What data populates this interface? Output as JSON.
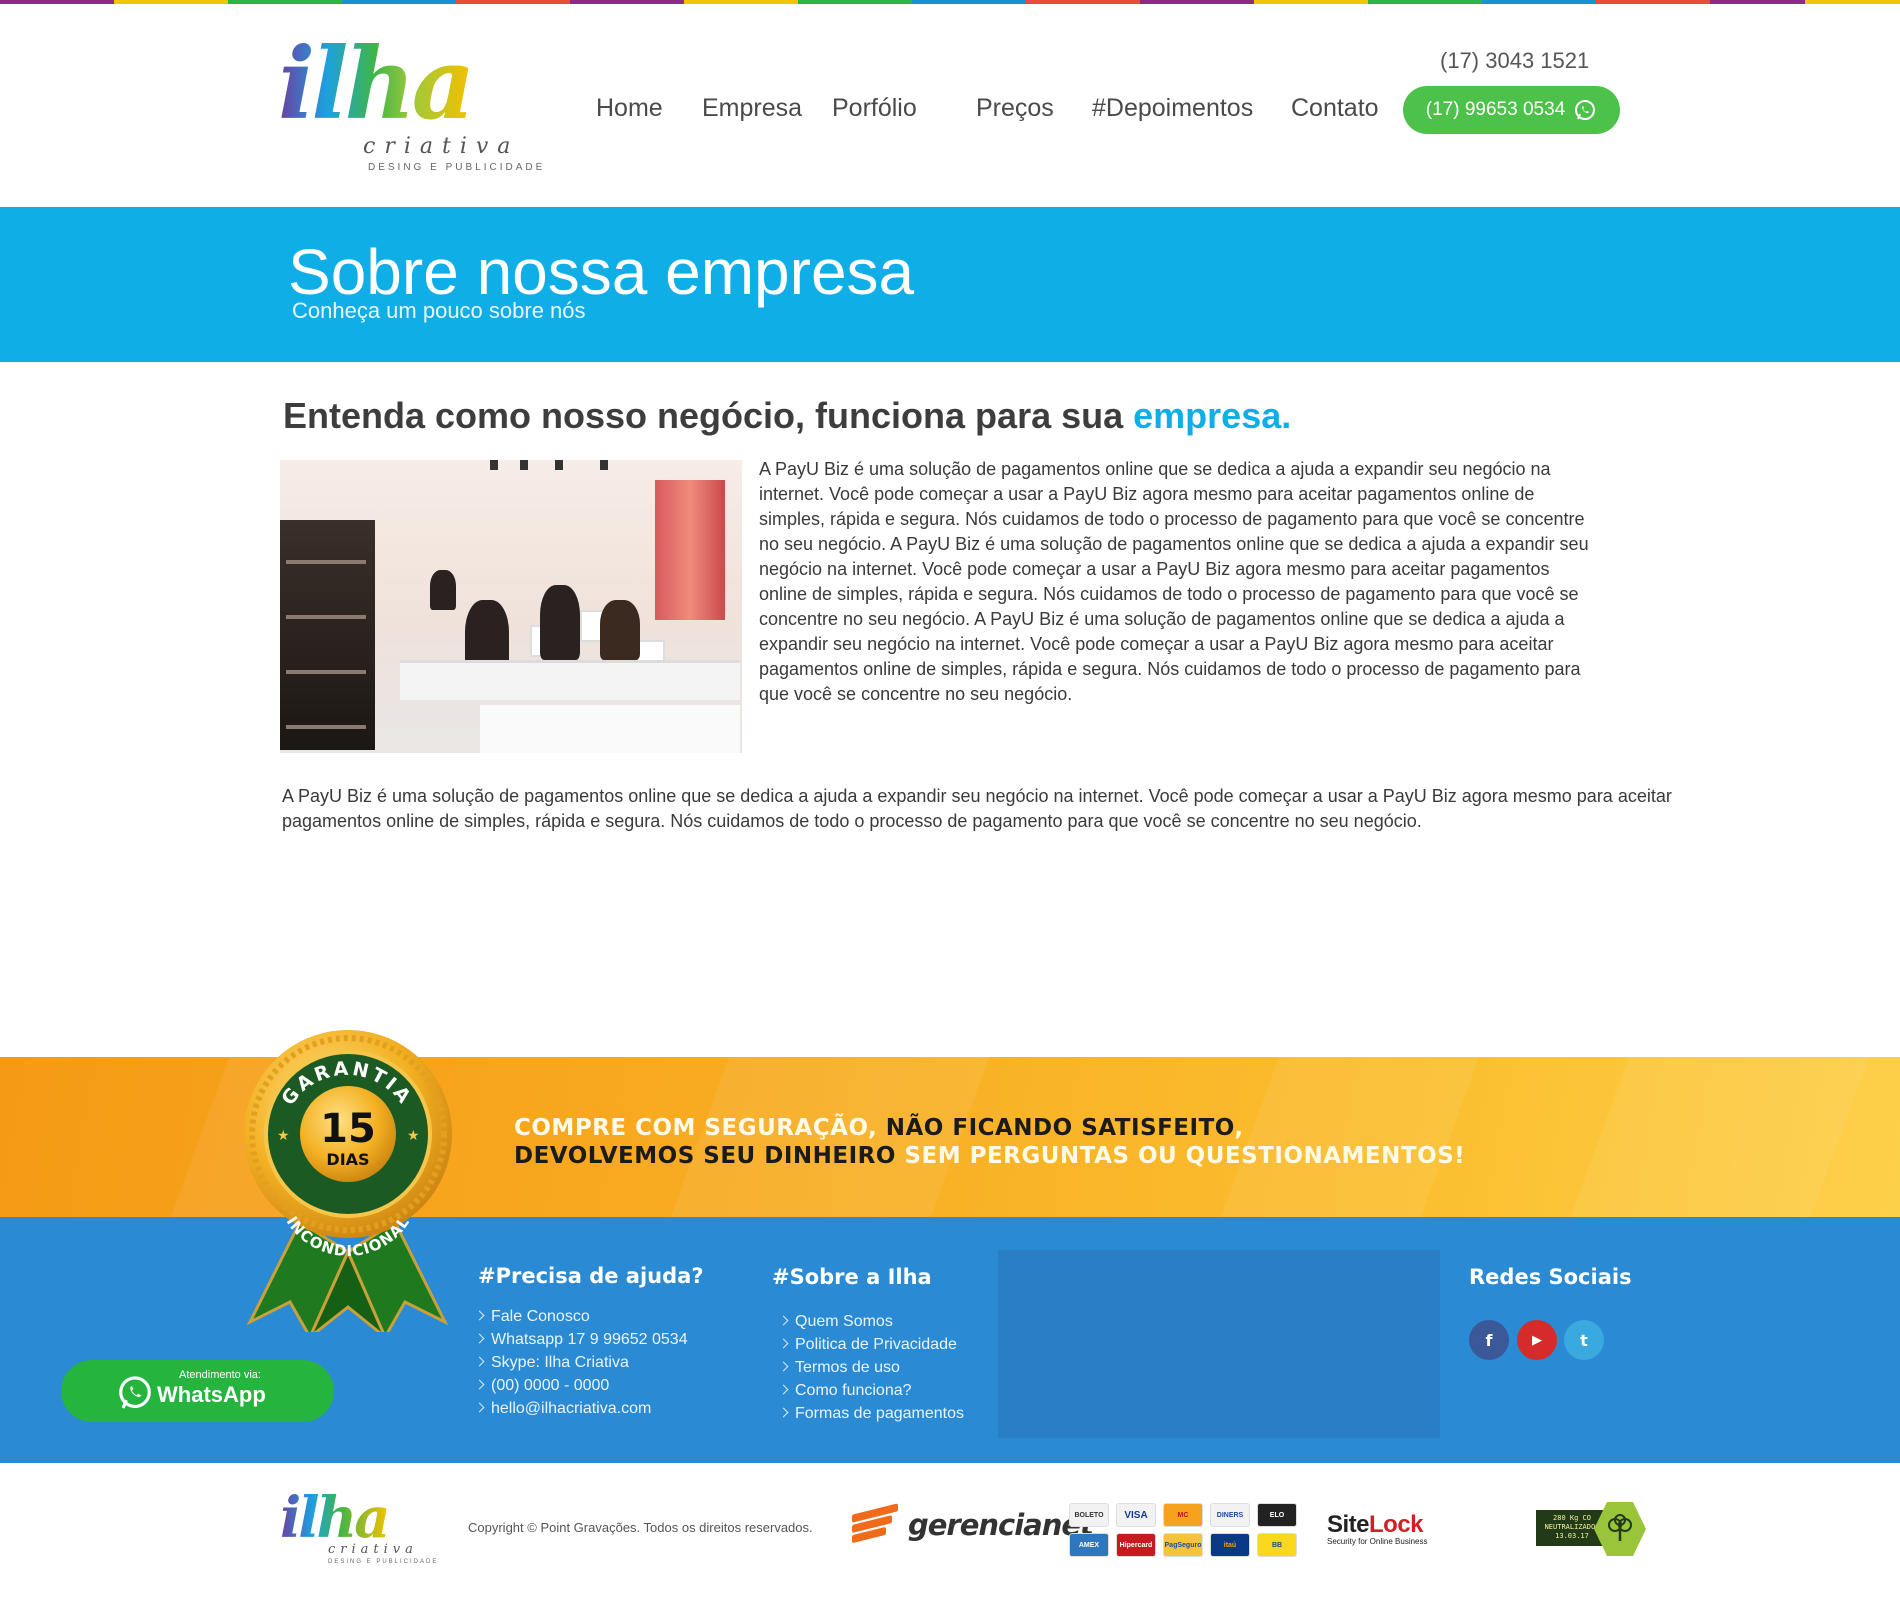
{
  "header": {
    "logo": {
      "word": "ilha",
      "sub": "criativa",
      "tag": "DESING E PUBLICIDADE"
    },
    "phone": "(17) 3043 1521",
    "nav": [
      "Home",
      "Empresa",
      "Porfólio",
      "Preços",
      "#Depoimentos",
      "Contato"
    ],
    "whatsapp_number": "(17) 99653 0534"
  },
  "banner": {
    "title": "Sobre nossa empresa",
    "subtitle": "Conheça um pouco sobre nós",
    "color": "#10aee6"
  },
  "content": {
    "heading_main": "Entenda como nosso negócio, funciona para sua ",
    "heading_highlight": "empresa.",
    "paragraph1": "A PayU Biz é uma solução de pagamentos online que se dedica a ajuda a expandir seu negócio na internet. Você pode começar a usar a PayU Biz agora mesmo para aceitar pagamentos online de simples, rápida e segura. Nós cuidamos de todo o processo de pagamento para que você se concentre no seu negócio. A PayU Biz é uma solução de pagamentos online que se dedica a ajuda a expandir seu negócio na internet. Você pode começar a usar a PayU Biz agora mesmo para aceitar pagamentos online de simples, rápida e segura. Nós cuidamos de todo o processo de pagamento para que você se concentre no seu negócio. A PayU Biz é uma solução de pagamentos online que se dedica a ajuda a expandir seu negócio na internet. Você pode começar a usar a PayU Biz agora mesmo para aceitar pagamentos online de simples, rápida e segura. Nós cuidamos de todo o processo de pagamento para que você se concentre no seu negócio.",
    "paragraph2": "A PayU Biz é uma solução de pagamentos online que se dedica a ajuda a expandir seu negócio na internet. Você pode começar a usar a PayU Biz agora mesmo para aceitar pagamentos online de simples, rápida e segura. Nós cuidamos de todo o processo de pagamento para que você se concentre no seu negócio."
  },
  "guarantee": {
    "seal": {
      "top": "GARANTIA",
      "number": "15",
      "unit": "DIAS",
      "bottom": "INCONDICIONAL"
    },
    "line1_a": "COMPRE COM SEGURAÇÃO, ",
    "line1_b": "NÃO FICANDO SATISFEITO",
    "line1_c": ",",
    "line2_a": "DEVOLVEMOS SEU DINHEIRO",
    "line2_b": " SEM PERGUNTAS OU QUESTIONAMENTOS!"
  },
  "footer": {
    "help": {
      "title": "#Precisa de ajuda?",
      "items": [
        "Fale Conosco",
        "Whatsapp 17 9 99652 0534",
        "Skype: Ilha Criativa",
        "(00) 0000 - 0000",
        "hello@ilhacriativa.com"
      ]
    },
    "about": {
      "title": "#Sobre a Ilha",
      "items": [
        "Quem Somos",
        "Politica de Privacidade",
        "Termos de uso",
        "Como funciona?",
        "Formas de pagamentos"
      ]
    },
    "social": {
      "title": "Redes Sociais",
      "icons": [
        {
          "name": "facebook-icon",
          "glyph": "f",
          "color": "#3b5998"
        },
        {
          "name": "youtube-icon",
          "glyph": "▶",
          "color": "#d62b2b"
        },
        {
          "name": "twitter-icon",
          "glyph": "t",
          "color": "#3aa9e0"
        }
      ]
    },
    "whatsapp_button": {
      "small": "Atendimento via:",
      "big": "WhatsApp"
    }
  },
  "bottom": {
    "copyright": "Copyright © Point Gravações. Todos os direitos reservados.",
    "gerencianet": "gerencianet",
    "payment_icons": [
      "BOLETO",
      "VISA",
      "MC",
      "DINERS",
      "ELO",
      "AMEX",
      "Hipercard",
      "PagSeguro",
      "itaú",
      "BB"
    ],
    "sitelock": {
      "site": "Site",
      "lock": "Lock",
      "tagline": "Security for Online Business"
    },
    "carbon": {
      "line1": "280 Kg CO",
      "line2": "NEUTRALIZADOS",
      "line3": "13.03.17"
    }
  }
}
